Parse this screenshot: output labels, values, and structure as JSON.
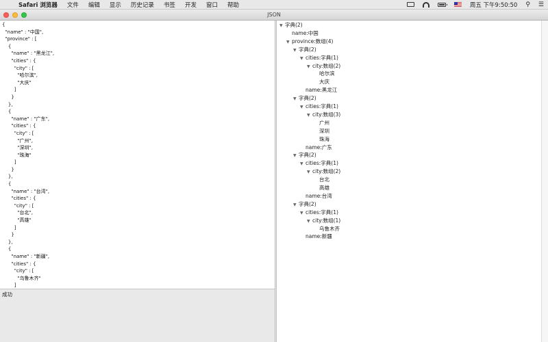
{
  "menubar": {
    "items": [
      "Safari 浏览器",
      "文件",
      "编辑",
      "显示",
      "历史记录",
      "书签",
      "开发",
      "窗口",
      "帮助"
    ],
    "clock": "周五 下午9:50:50"
  },
  "window": {
    "title": "JSON"
  },
  "editor": {
    "lines": [
      "{",
      "  \"name\" : \"中国\",",
      "  \"province\" : [",
      "    {",
      "      \"name\" : \"黑龙江\",",
      "      \"cities\" : {",
      "        \"city\" : [",
      "          \"哈尔滨\",",
      "          \"大庆\"",
      "        ]",
      "      }",
      "    },",
      "    {",
      "      \"name\" : \"广东\",",
      "      \"cities\" : {",
      "        \"city\" : [",
      "          \"广州\",",
      "          \"深圳\",",
      "          \"珠海\"",
      "        ]",
      "      }",
      "    },",
      "    {",
      "      \"name\" : \"台湾\",",
      "      \"cities\" : {",
      "        \"city\" : [",
      "          \"台北\",",
      "          \"高雄\"",
      "        ]",
      "      }",
      "    },",
      "    {",
      "      \"name\" : \"新疆\",",
      "      \"cities\" : {",
      "        \"city\" : [",
      "          \"乌鲁木齐\"",
      "        ]",
      "      }"
    ]
  },
  "status": {
    "message": "成功"
  },
  "tree": {
    "rows": [
      {
        "depth": 0,
        "expanded": true,
        "label": "字典(2)"
      },
      {
        "depth": 1,
        "expanded": null,
        "label": "name:中国"
      },
      {
        "depth": 1,
        "expanded": true,
        "label": "province:数组(4)"
      },
      {
        "depth": 2,
        "expanded": true,
        "label": "字典(2)"
      },
      {
        "depth": 3,
        "expanded": true,
        "label": "cities:字典(1)"
      },
      {
        "depth": 4,
        "expanded": true,
        "label": "city:数组(2)"
      },
      {
        "depth": 5,
        "expanded": null,
        "label": "哈尔滨"
      },
      {
        "depth": 5,
        "expanded": null,
        "label": "大庆"
      },
      {
        "depth": 3,
        "expanded": null,
        "label": "name:黑龙江"
      },
      {
        "depth": 2,
        "expanded": true,
        "label": "字典(2)"
      },
      {
        "depth": 3,
        "expanded": true,
        "label": "cities:字典(1)"
      },
      {
        "depth": 4,
        "expanded": true,
        "label": "city:数组(3)"
      },
      {
        "depth": 5,
        "expanded": null,
        "label": "广州"
      },
      {
        "depth": 5,
        "expanded": null,
        "label": "深圳"
      },
      {
        "depth": 5,
        "expanded": null,
        "label": "珠海"
      },
      {
        "depth": 3,
        "expanded": null,
        "label": "name:广东"
      },
      {
        "depth": 2,
        "expanded": true,
        "label": "字典(2)"
      },
      {
        "depth": 3,
        "expanded": true,
        "label": "cities:字典(1)"
      },
      {
        "depth": 4,
        "expanded": true,
        "label": "city:数组(2)"
      },
      {
        "depth": 5,
        "expanded": null,
        "label": "台北"
      },
      {
        "depth": 5,
        "expanded": null,
        "label": "高雄"
      },
      {
        "depth": 3,
        "expanded": null,
        "label": "name:台湾"
      },
      {
        "depth": 2,
        "expanded": true,
        "label": "字典(2)"
      },
      {
        "depth": 3,
        "expanded": true,
        "label": "cities:字典(1)"
      },
      {
        "depth": 4,
        "expanded": true,
        "label": "city:数组(1)"
      },
      {
        "depth": 5,
        "expanded": null,
        "label": "乌鲁木齐"
      },
      {
        "depth": 3,
        "expanded": null,
        "label": "name:新疆"
      }
    ]
  }
}
